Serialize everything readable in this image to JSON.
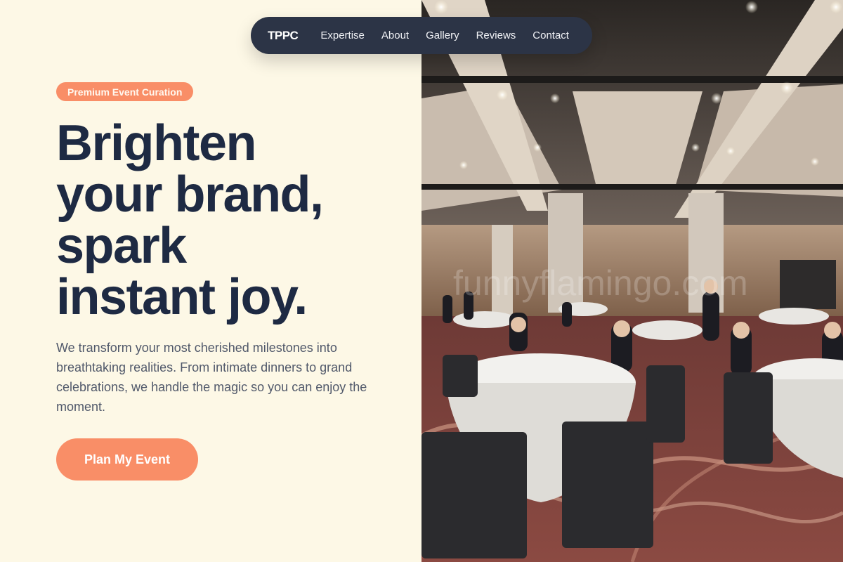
{
  "nav": {
    "brand": "TPPC",
    "links": [
      "Expertise",
      "About",
      "Gallery",
      "Reviews",
      "Contact"
    ]
  },
  "hero": {
    "badge": "Premium Event Curation",
    "headline_lines": [
      "Brighten",
      "your brand,",
      "spark",
      "instant joy."
    ],
    "subtext": "We transform your most cherished milestones into breathtaking realities. From intimate dinners to grand celebrations, we handle the magic so you can enjoy the moment.",
    "cta_label": "Plan My Event"
  },
  "image": {
    "watermark": "funnyflamingo.com"
  },
  "colors": {
    "background": "#fdf8e6",
    "accent": "#f98e67",
    "heading": "#1e2a43",
    "navbar": "#2c3446"
  }
}
